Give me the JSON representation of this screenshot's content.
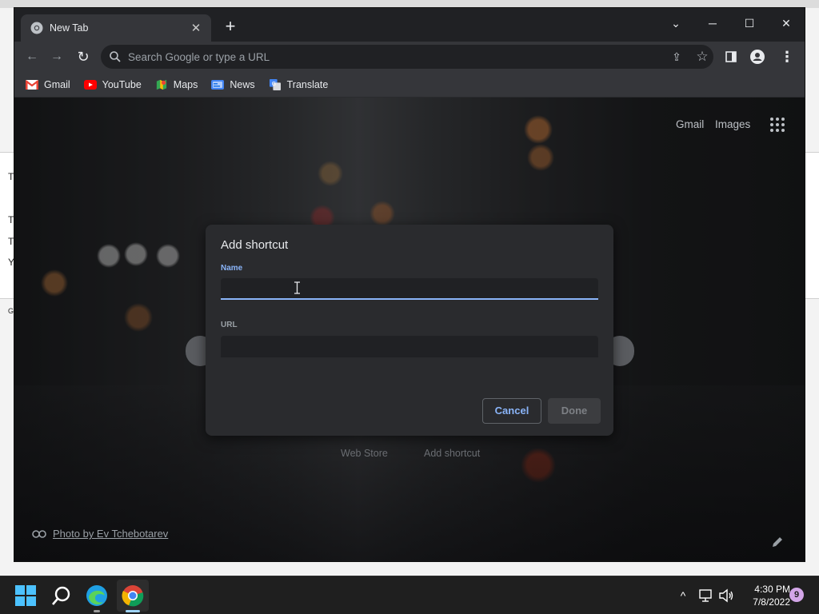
{
  "window": {
    "tab_title": "New Tab",
    "tab_close_glyph": "✕",
    "new_tab_glyph": "+",
    "controls": {
      "minimize": "─",
      "maximize": "☐",
      "close": "✕",
      "tab_search": "⌄"
    }
  },
  "toolbar": {
    "back_glyph": "←",
    "forward_glyph": "→",
    "reload_glyph": "↻",
    "omnibox_placeholder": "Search Google or type a URL",
    "share_glyph": "⇪",
    "bookmark_glyph": "☆",
    "menu_glyph": "⋮"
  },
  "bookmarks": [
    {
      "label": "Gmail",
      "icon": "gmail-icon"
    },
    {
      "label": "YouTube",
      "icon": "youtube-icon"
    },
    {
      "label": "Maps",
      "icon": "maps-icon"
    },
    {
      "label": "News",
      "icon": "news-icon"
    },
    {
      "label": "Translate",
      "icon": "translate-icon"
    }
  ],
  "ntp": {
    "gmail_link": "Gmail",
    "images_link": "Images",
    "web_store": "Web Store",
    "add_shortcut": "Add shortcut",
    "photo_credit": "Photo by Ev Tchebotarev"
  },
  "dialog": {
    "title": "Add shortcut",
    "name_label": "Name",
    "name_value": "",
    "url_label": "URL",
    "url_value": "",
    "cancel_label": "Cancel",
    "done_label": "Done"
  },
  "taskbar": {
    "time": "4:30 PM",
    "date": "7/8/2022",
    "notification_count": "9",
    "tray_chevron": "^"
  },
  "colors": {
    "accent": "#8ab4f8",
    "dialog_bg": "#2a2b2e",
    "toolbar_bg": "#35363a",
    "frame_bg": "#202124"
  }
}
